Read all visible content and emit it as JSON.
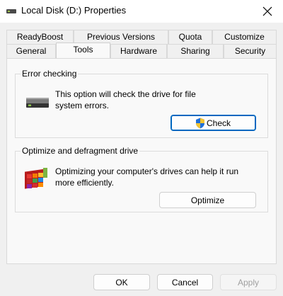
{
  "window": {
    "title": "Local Disk (D:) Properties",
    "icon": "drive-icon",
    "close_icon": "close-icon"
  },
  "tabs_row1": [
    {
      "label": "ReadyBoost"
    },
    {
      "label": "Previous Versions"
    },
    {
      "label": "Quota"
    },
    {
      "label": "Customize"
    }
  ],
  "tabs_row2": [
    {
      "label": "General"
    },
    {
      "label": "Tools",
      "selected": true
    },
    {
      "label": "Hardware"
    },
    {
      "label": "Sharing"
    },
    {
      "label": "Security"
    }
  ],
  "error_checking": {
    "title": "Error checking",
    "description_line1": "This option will check the drive for file",
    "description_line2": "system errors.",
    "icon": "hard-drive-icon",
    "button_label": "Check",
    "button_icon": "uac-shield-icon"
  },
  "optimize": {
    "title": "Optimize and defragment drive",
    "description_line1": "Optimizing your computer's drives can help it run",
    "description_line2": "more efficiently.",
    "icon": "defrag-icon",
    "button_label": "Optimize"
  },
  "footer": {
    "ok_label": "OK",
    "cancel_label": "Cancel",
    "apply_label": "Apply"
  },
  "colors": {
    "accent": "#0067c0",
    "window_bg": "#f0f0f0",
    "panel_bg": "#f9f9f9"
  }
}
